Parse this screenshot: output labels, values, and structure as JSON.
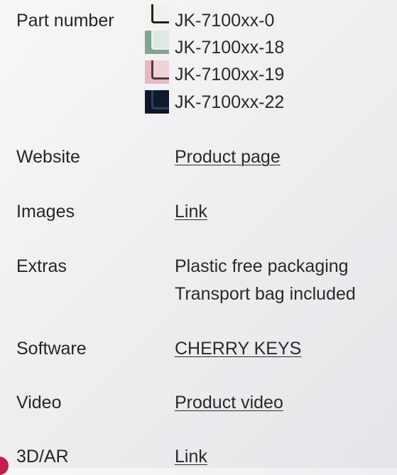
{
  "labels": {
    "part_number": "Part number",
    "website": "Website",
    "images": "Images",
    "extras": "Extras",
    "software": "Software",
    "video": "Video",
    "ar": "3D/AR"
  },
  "part_numbers": [
    {
      "code": "JK-7100xx-0",
      "color": "#f1f1ec"
    },
    {
      "code": "JK-7100xx-18",
      "color": "#82a593"
    },
    {
      "code": "JK-7100xx-19",
      "color": "#e6b9c2"
    },
    {
      "code": "JK-7100xx-22",
      "color": "#0d1626"
    }
  ],
  "values": {
    "website": "Product page",
    "images": "Link",
    "extras_1": "Plastic free packaging",
    "extras_2": "Transport bag included",
    "software": "CHERRY KEYS",
    "video": "Product video",
    "ar": "Link"
  },
  "colors": {
    "text": "#2a2a2a",
    "accent": "#c41e4a"
  }
}
